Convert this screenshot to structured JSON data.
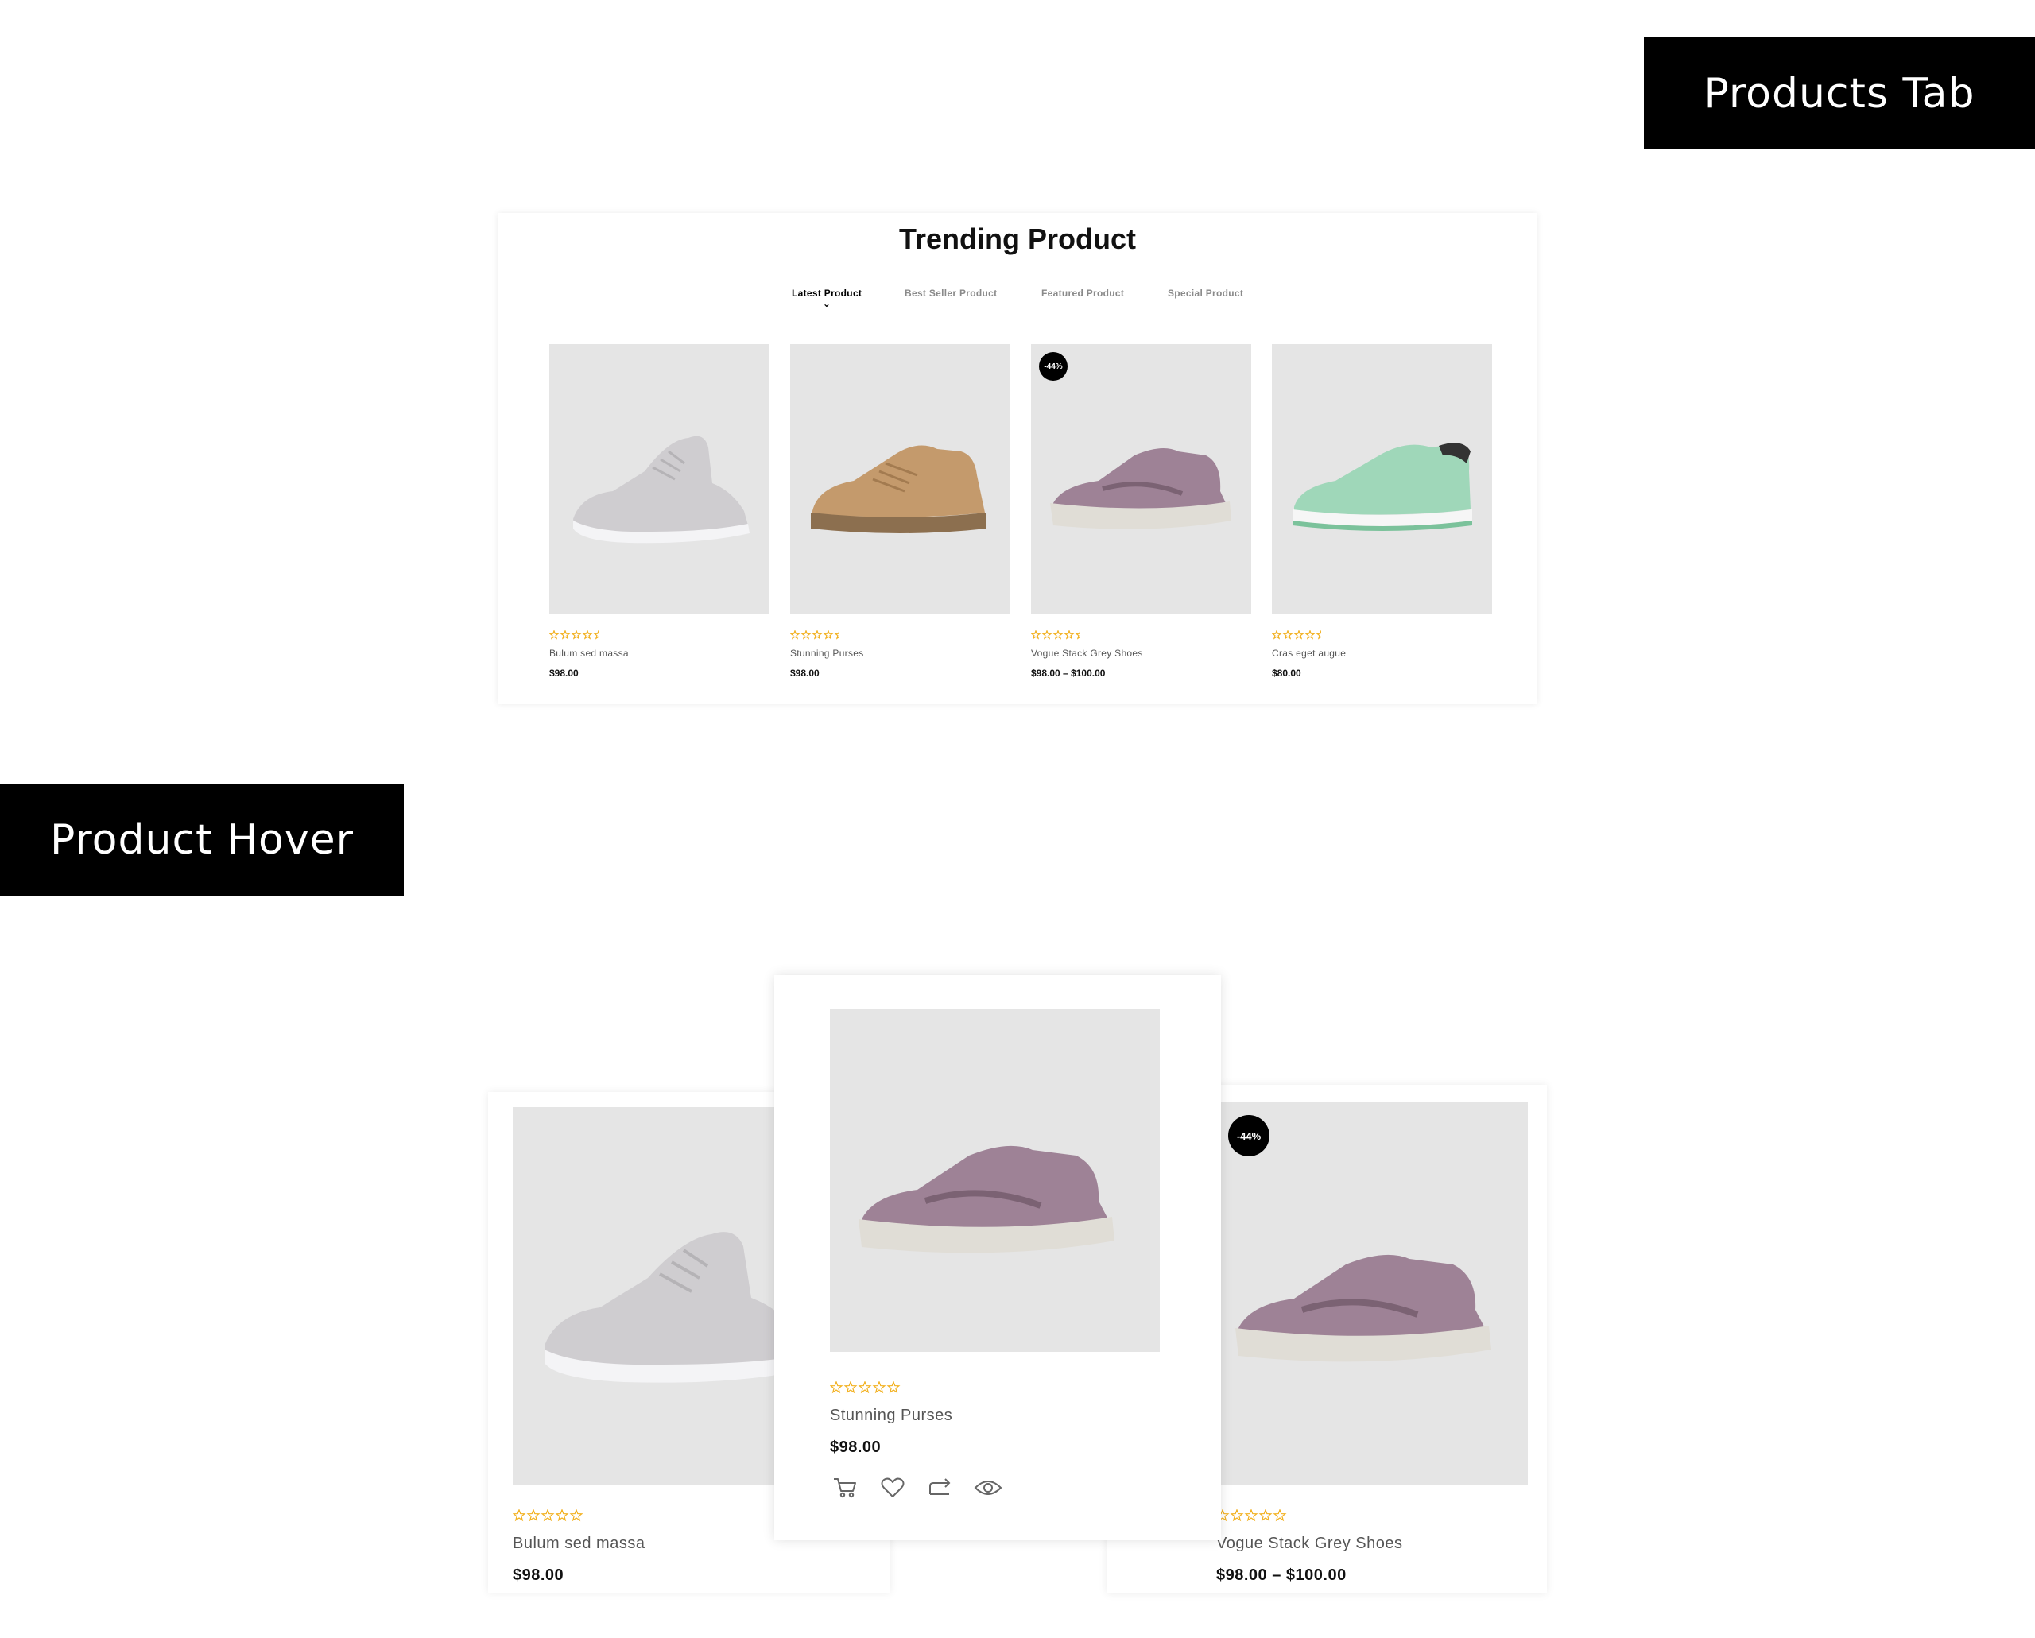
{
  "banners": {
    "top": "Products Tab",
    "left": "Product Hover"
  },
  "section": {
    "title": "Trending Product",
    "tabs": [
      {
        "label": "Latest Product",
        "active": true
      },
      {
        "label": "Best Seller Product",
        "active": false
      },
      {
        "label": "Featured Product",
        "active": false
      },
      {
        "label": "Special Product",
        "active": false
      }
    ],
    "products": [
      {
        "name": "Bulum sed massa",
        "price": "$98.00",
        "rating": 0,
        "shoe": "white-sneaker"
      },
      {
        "name": "Stunning Purses",
        "price": "$98.00",
        "rating": 0,
        "shoe": "tan-sneaker"
      },
      {
        "name": "Vogue Stack Grey Shoes",
        "price": "$98.00 – $100.00",
        "rating": 0,
        "badge": "-44%",
        "shoe": "mauve-sneaker"
      },
      {
        "name": "Cras eget augue",
        "price": "$80.00",
        "rating": 0,
        "shoe": "mint-sneaker"
      }
    ]
  },
  "hover": {
    "left": {
      "name": "Bulum sed massa",
      "price": "$98.00",
      "rating": 0,
      "shoe": "white-sneaker"
    },
    "middle": {
      "name": "Stunning Purses",
      "price": "$98.00",
      "rating": 0,
      "shoe": "mauve-sneaker",
      "actions": [
        "cart-icon",
        "heart-icon",
        "compare-icon",
        "eye-icon"
      ]
    },
    "right": {
      "name": "Vogue Stack Grey Shoes",
      "price": "$98.00 – $100.00",
      "rating": 0,
      "badge": "-44%",
      "shoe": "mauve-sneaker"
    }
  },
  "colors": {
    "banner_bg": "#000000",
    "image_bg": "#e5e5e5",
    "star": "#f2b01e",
    "badge_bg": "#000000"
  }
}
